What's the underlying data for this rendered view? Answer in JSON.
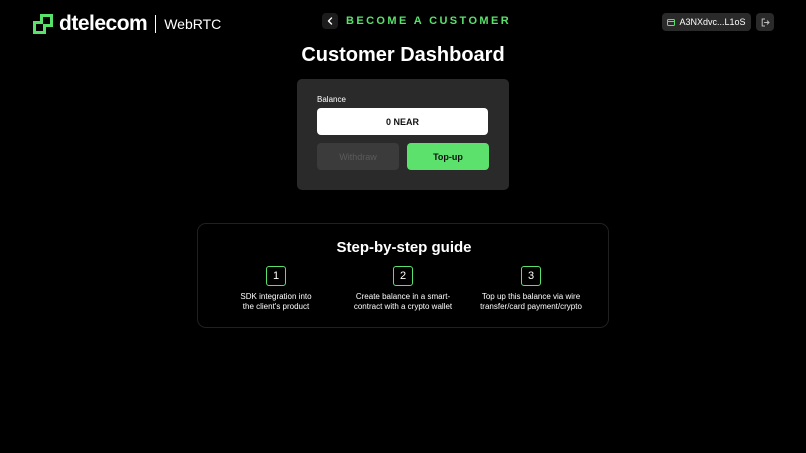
{
  "header": {
    "brand_name": "dtelecom",
    "product_name": "WebRTC",
    "nav_label": "BECOME A CUSTOMER",
    "wallet_address": "A3NXdvc...L1oS",
    "accent_color": "#59e26b"
  },
  "dashboard": {
    "title": "Customer Dashboard",
    "balance_label": "Balance",
    "balance_value": "0 NEAR",
    "withdraw_label": "Withdraw",
    "topup_label": "Top-up"
  },
  "guide": {
    "title": "Step-by-step guide",
    "steps": [
      {
        "number": "1",
        "line1": "SDK integration into",
        "line2": "the client's product"
      },
      {
        "number": "2",
        "line1": "Create balance in a smart-",
        "line2": "contract with a crypto wallet"
      },
      {
        "number": "3",
        "line1": "Top up this balance via wire",
        "line2": "transfer/card payment/crypto"
      }
    ]
  }
}
